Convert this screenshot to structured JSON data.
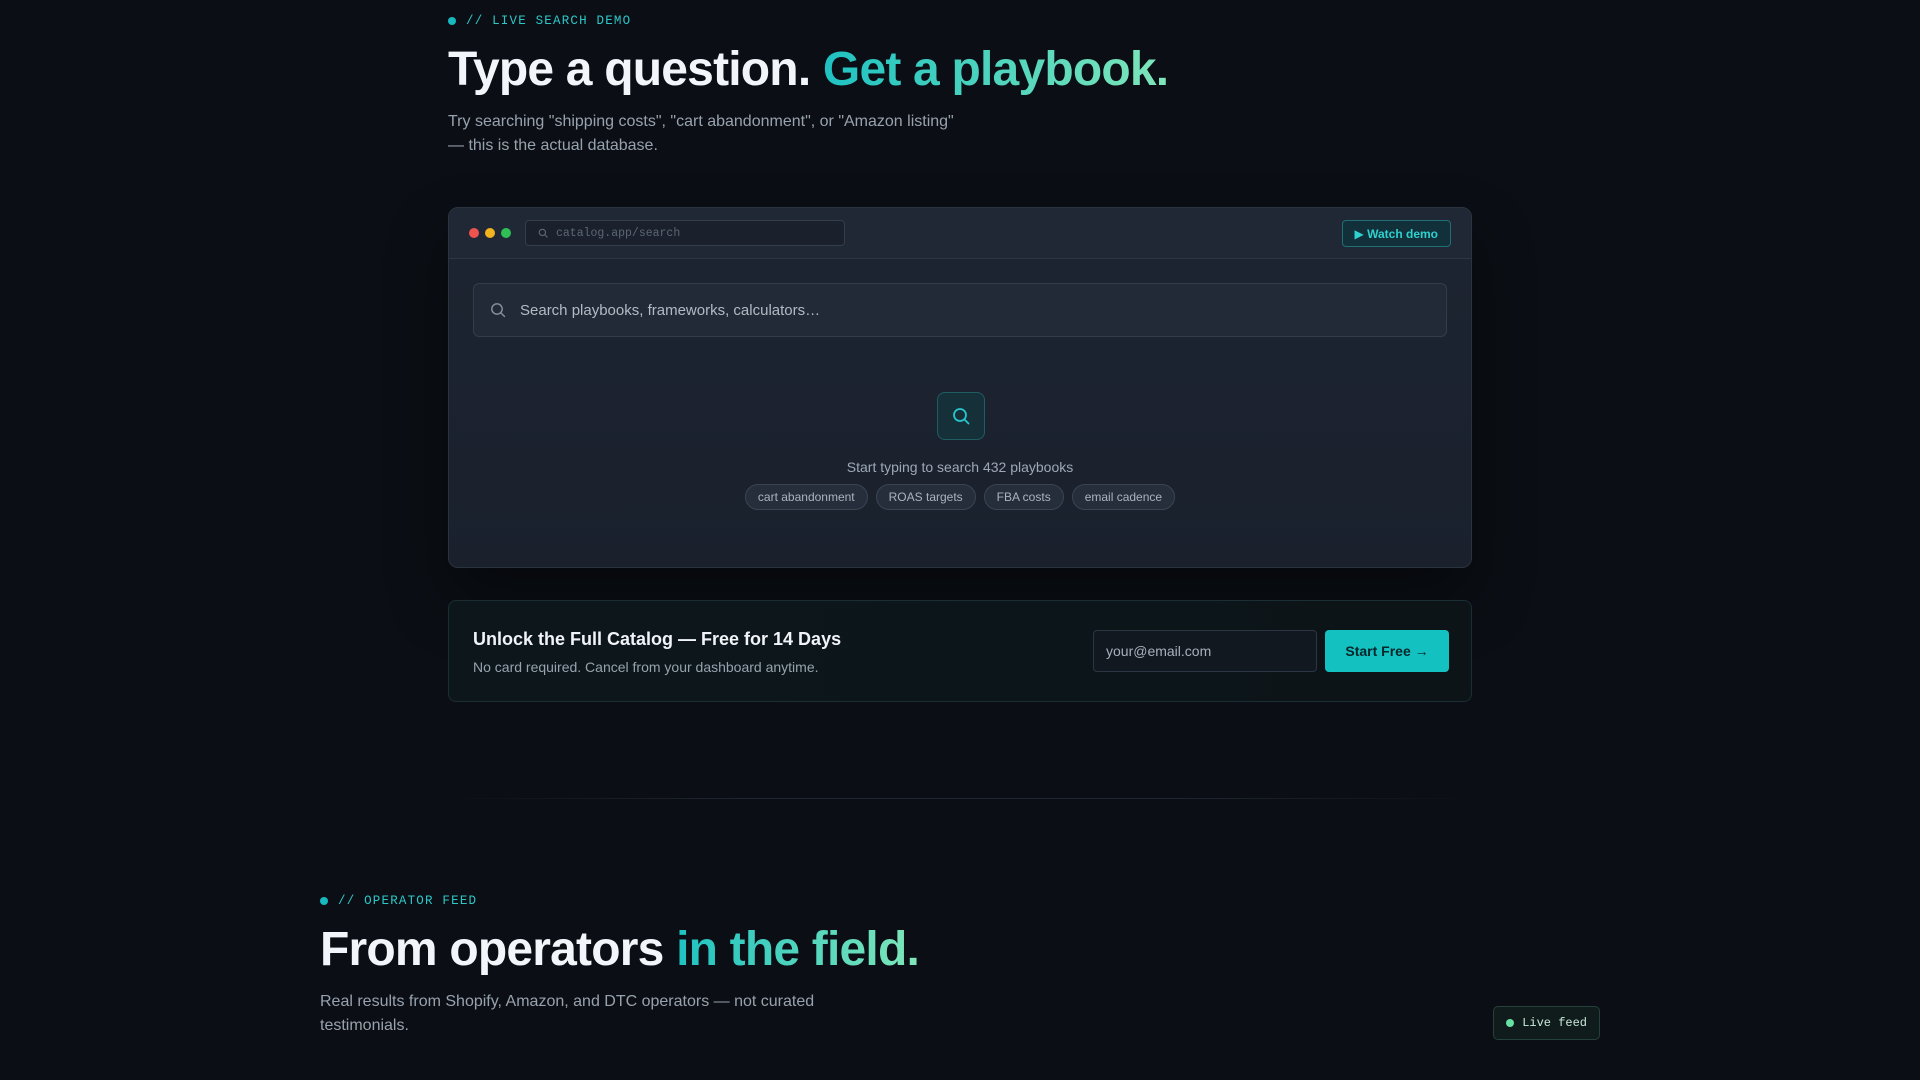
{
  "search_demo": {
    "eyebrow": "// LIVE SEARCH DEMO",
    "headline_plain": "Type a question. ",
    "headline_accent": "Get a playbook.",
    "subtitle": "Try searching \"shipping costs\", \"cart abandonment\", or \"Amazon listing\" — this is the actual database.",
    "browser": {
      "url": "catalog.app/search",
      "watch_demo_label": "▶ Watch demo",
      "search_placeholder": "Search playbooks, frameworks, calculators…",
      "empty_state_text": "Start typing to search 432 playbooks",
      "suggestion_chips": [
        "cart abandonment",
        "ROAS targets",
        "FBA costs",
        "email cadence"
      ],
      "traffic_lights": [
        "#ef5350",
        "#f2b41e",
        "#2fbf55"
      ]
    }
  },
  "cta": {
    "title": "Unlock the Full Catalog — Free for 14 Days",
    "subtitle": "No card required. Cancel from your dashboard anytime.",
    "email_placeholder": "your@email.com",
    "button_label": "Start Free →"
  },
  "operator_feed": {
    "eyebrow": "// OPERATOR FEED",
    "headline_plain": "From operators ",
    "headline_accent": "in the field.",
    "subtitle": "Real results from Shopify, Amazon, and DTC operators — not curated testimonials.",
    "live_badge": "Live feed"
  },
  "colors": {
    "background": "#0b0f15",
    "accent": "#14c1c1",
    "accent_gradient_end": "#7fe6b9",
    "live_dot": "#67e0a3"
  }
}
